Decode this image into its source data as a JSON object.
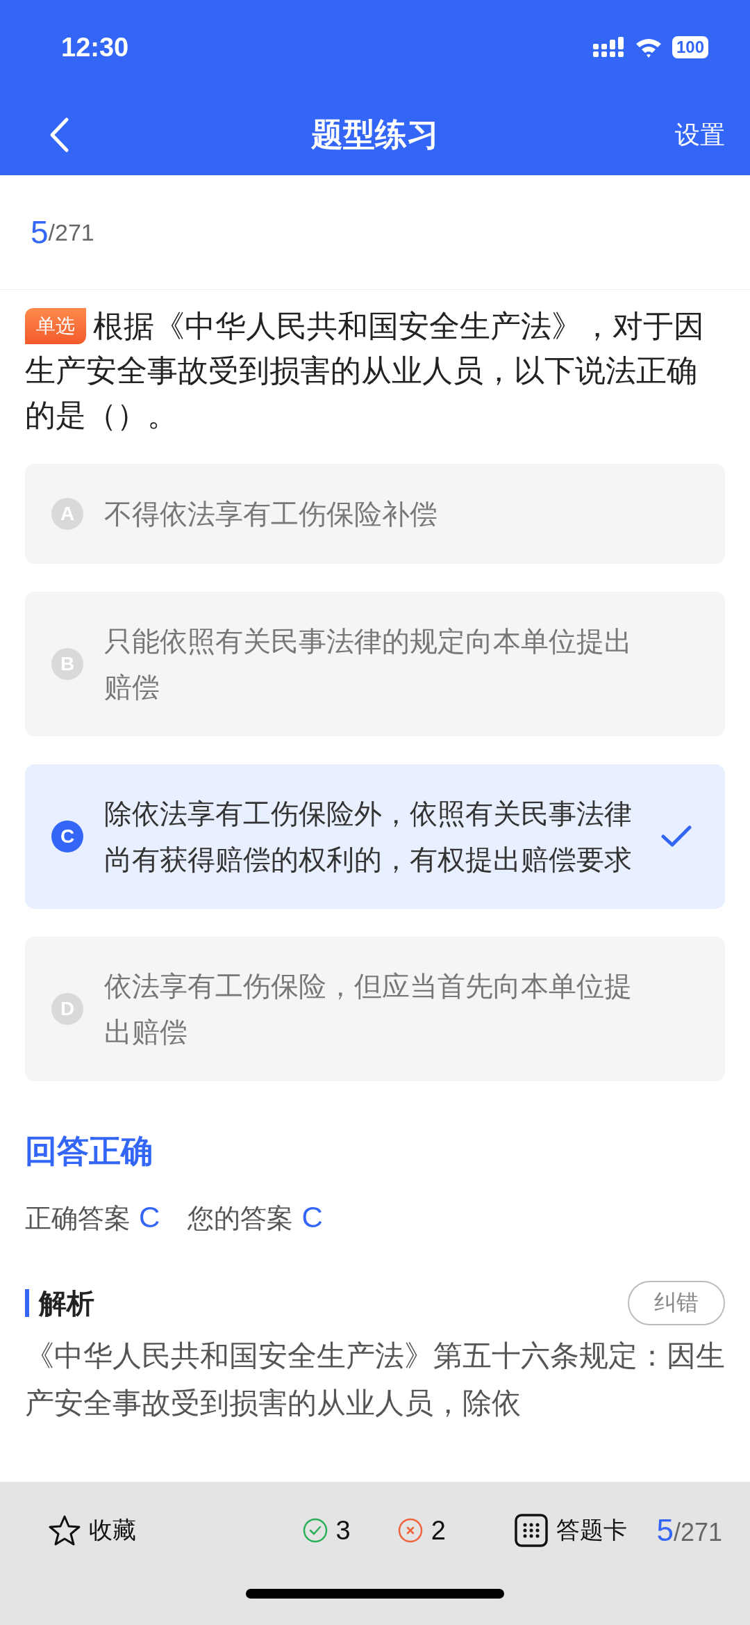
{
  "status_bar": {
    "time": "12:30",
    "battery": "100"
  },
  "nav": {
    "title": "题型练习",
    "action": "设置"
  },
  "progress": {
    "current": "5",
    "total": "/271"
  },
  "question": {
    "type_tag": "单选",
    "text": "根据《中华人民共和国安全生产法》，对于因生产安全事故受到损害的从业人员，以下说法正确的是（）。"
  },
  "options": [
    {
      "letter": "A",
      "text": "不得依法享有工伤保险补偿",
      "selected": false
    },
    {
      "letter": "B",
      "text": "只能依照有关民事法律的规定向本单位提出赔偿",
      "selected": false
    },
    {
      "letter": "C",
      "text": "除依法享有工伤保险外，依照有关民事法律尚有获得赔偿的权利的，有权提出赔偿要求",
      "selected": true
    },
    {
      "letter": "D",
      "text": "依法享有工伤保险，但应当首先向本单位提出赔偿",
      "selected": false
    }
  ],
  "result": {
    "title": "回答正确",
    "correct_label": "正确答案",
    "correct": "C",
    "yours_label": "您的答案",
    "yours": "C"
  },
  "analysis": {
    "title": "解析",
    "report_button": "纠错",
    "text": "《中华人民共和国安全生产法》第五十六条规定：因生产安全事故受到损害的从业人员，除依"
  },
  "bottom_bar": {
    "favorite": "收藏",
    "right_count": "3",
    "wrong_count": "2",
    "answer_card": "答题卡",
    "current": "5",
    "total": "/271"
  }
}
